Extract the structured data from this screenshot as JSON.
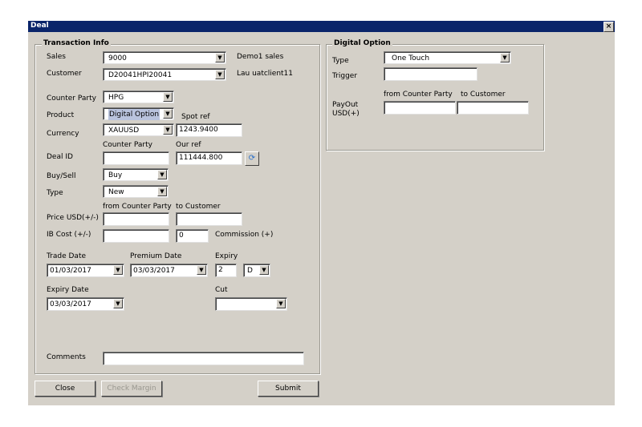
{
  "window": {
    "title": "Deal",
    "close_glyph": "×"
  },
  "transaction": {
    "legend": "Transaction Info",
    "sales": {
      "label": "Sales",
      "value": "9000",
      "info": "Demo1 sales"
    },
    "customer": {
      "label": "Customer",
      "value": "D20041HPI20041",
      "info": "Lau uatclient11"
    },
    "counter_party": {
      "label": "Counter Party",
      "value": "HPG"
    },
    "product": {
      "label": "Product",
      "value": "Digital Option"
    },
    "spot_ref_label": "Spot ref",
    "currency": {
      "label": "Currency",
      "value": "XAUUSD",
      "spot_ref": "1243.9400"
    },
    "deal_id": {
      "label": "Deal ID",
      "counter_party_label": "Counter Party",
      "our_ref_label": "Our ref",
      "counter_party_value": "",
      "our_ref_value": "111444.800"
    },
    "buy_sell": {
      "label": "Buy/Sell",
      "value": "Buy"
    },
    "type": {
      "label": "Type",
      "value": "New"
    },
    "price": {
      "label": "Price USD(+/-)",
      "from_label": "from Counter Party",
      "to_label": "to Customer",
      "from_value": "",
      "to_value": ""
    },
    "ib_cost": {
      "label": "IB Cost (+/-)",
      "value": "",
      "commission_value": "0",
      "commission_label": "Commission (+)"
    },
    "trade_date": {
      "label": "Trade Date",
      "value": "01/03/2017"
    },
    "premium_date": {
      "label": "Premium Date",
      "value": "03/03/2017"
    },
    "expiry": {
      "label": "Expiry",
      "value": "2",
      "unit": "D"
    },
    "expiry_date": {
      "label": "Expiry Date",
      "value": "03/03/2017"
    },
    "cut": {
      "label": "Cut",
      "value": ""
    },
    "comments": {
      "label": "Comments",
      "value": ""
    }
  },
  "digital": {
    "legend": "Digital Option",
    "type": {
      "label": "Type",
      "value": "One Touch"
    },
    "trigger": {
      "label": "Trigger",
      "value": ""
    },
    "payout": {
      "label": "PayOut USD(+)",
      "from_label": "from Counter Party",
      "to_label": "to Customer",
      "from_value": "",
      "to_value": ""
    }
  },
  "buttons": {
    "close": "Close",
    "check_margin": "Check Margin",
    "submit": "Submit"
  },
  "icons": {
    "dropdown_arrow": "▼",
    "refresh": "⟳"
  }
}
